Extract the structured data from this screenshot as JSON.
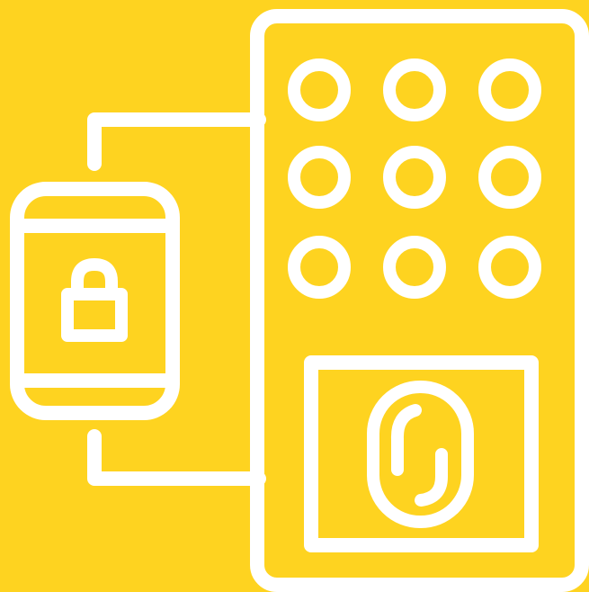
{
  "colors": {
    "background": "#FED320",
    "stroke": "#FFFFFF"
  },
  "icon": {
    "name": "smart-lock-phone-access-icon",
    "parts": [
      "smartphone-icon",
      "padlock-icon",
      "keypad-icon",
      "fingerprint-sensor-icon",
      "connection-lines"
    ]
  }
}
